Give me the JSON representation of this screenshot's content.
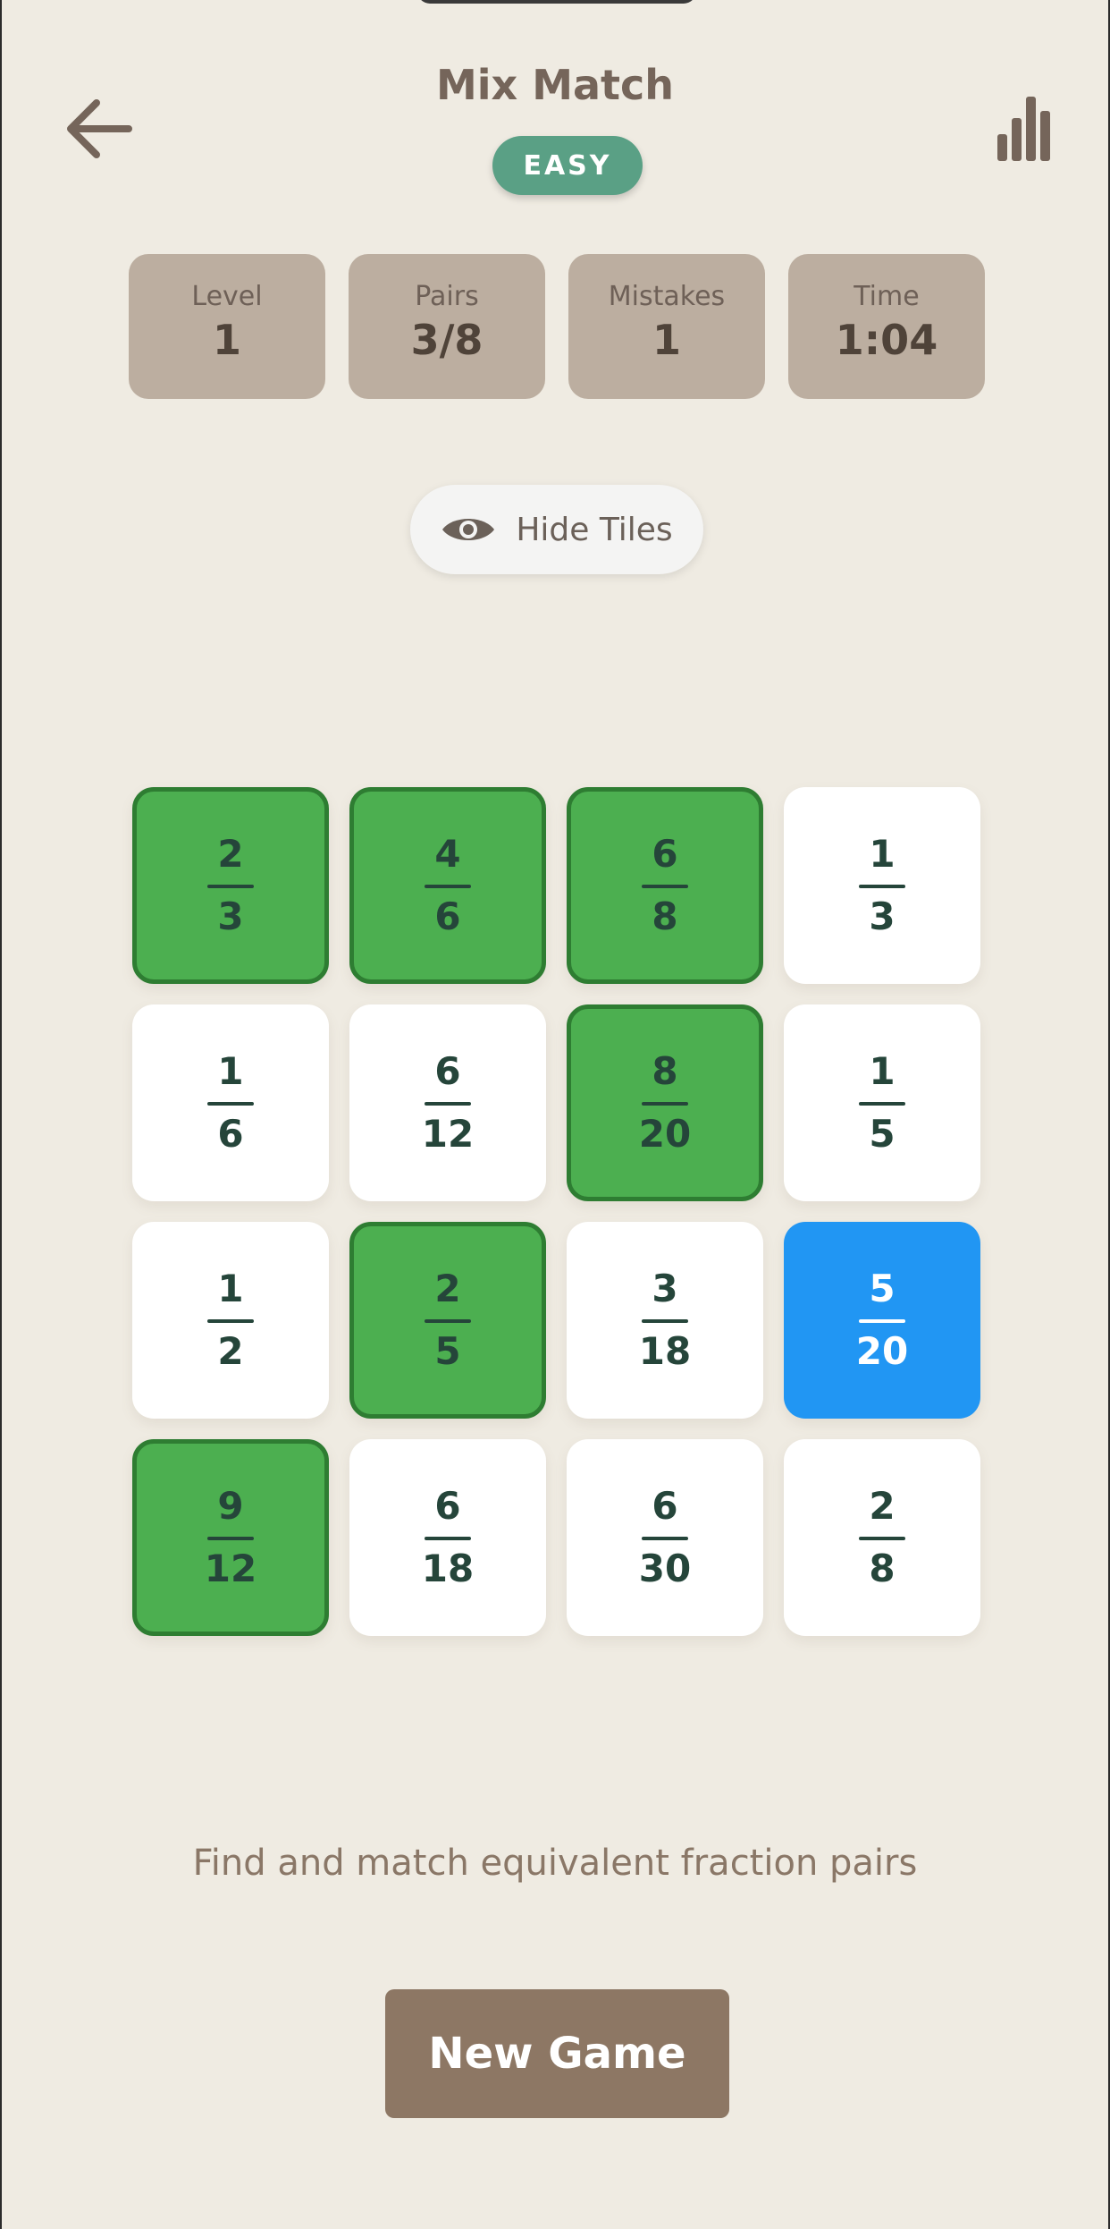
{
  "header": {
    "title": "Mix Match",
    "difficulty": "EASY",
    "back_icon": "arrow-left-icon",
    "stats_icon": "bar-chart-icon"
  },
  "stats": [
    {
      "label": "Level",
      "value": "1"
    },
    {
      "label": "Pairs",
      "value": "3/8"
    },
    {
      "label": "Mistakes",
      "value": "1"
    },
    {
      "label": "Time",
      "value": "1:04"
    }
  ],
  "hide_button": {
    "label": "Hide Tiles",
    "icon": "eye-icon"
  },
  "tiles": [
    {
      "num": "2",
      "den": "3",
      "state": "matched"
    },
    {
      "num": "4",
      "den": "6",
      "state": "matched"
    },
    {
      "num": "6",
      "den": "8",
      "state": "matched"
    },
    {
      "num": "1",
      "den": "3",
      "state": "default"
    },
    {
      "num": "1",
      "den": "6",
      "state": "default"
    },
    {
      "num": "6",
      "den": "12",
      "state": "default"
    },
    {
      "num": "8",
      "den": "20",
      "state": "matched"
    },
    {
      "num": "1",
      "den": "5",
      "state": "default"
    },
    {
      "num": "1",
      "den": "2",
      "state": "default"
    },
    {
      "num": "2",
      "den": "5",
      "state": "matched"
    },
    {
      "num": "3",
      "den": "18",
      "state": "default"
    },
    {
      "num": "5",
      "den": "20",
      "state": "selected"
    },
    {
      "num": "9",
      "den": "12",
      "state": "matched"
    },
    {
      "num": "6",
      "den": "18",
      "state": "default"
    },
    {
      "num": "6",
      "den": "30",
      "state": "default"
    },
    {
      "num": "2",
      "den": "8",
      "state": "default"
    }
  ],
  "instructions": "Find and match equivalent fraction pairs",
  "new_game_label": "New Game",
  "colors": {
    "matched": "#4caf50",
    "selected": "#2196f3",
    "default": "#ffffff",
    "background": "#efebe2",
    "accent": "#5aa085"
  }
}
